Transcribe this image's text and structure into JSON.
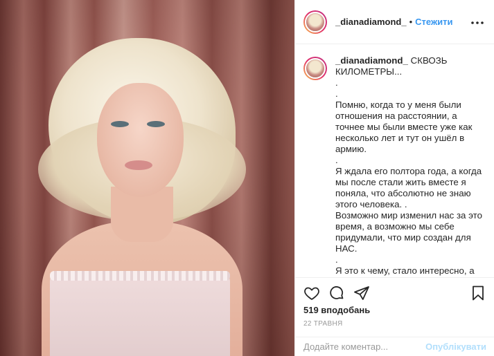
{
  "post": {
    "image_alt": "photo-woman-with-blonde-hair"
  },
  "header": {
    "username": "_dianadiamond_",
    "separator": "•",
    "follow_label": "Стежити",
    "more_icon": "more-horizontal-icon"
  },
  "caption": {
    "username": "_dianadiamond_",
    "text": " СКВОЗЬ КИЛОМЕТРЫ...\n.\n.\nПомню, когда то у меня были отношения на расстоянии, а точнее мы были вместе уже как несколько лет и тут он ушёл в армию.\n.\nЯ ждала его полтора года, а когда мы после стали жить вместе я поняла, что абсолютно не знаю этого человека. .\nВозможно мир изменил нас за это время, а возможно мы себе придумали, что мир создан для НАС.\n.\nЯ это к чему, стало интересно, а бывает ли все таки любовь на расстоянии, сквозь километры? ."
  },
  "actions": {
    "like_icon": "heart-icon",
    "comment_icon": "comment-icon",
    "share_icon": "share-icon",
    "save_icon": "bookmark-icon"
  },
  "likes": "519 вподобань",
  "date": "22 травня",
  "comment": {
    "placeholder": "Додайте коментар...",
    "publish_label": "Опублікувати"
  },
  "colors": {
    "accent": "#3897f0",
    "publish_disabled": "#b2dffc",
    "text": "#262626",
    "muted": "#999999",
    "border": "#efefef"
  }
}
